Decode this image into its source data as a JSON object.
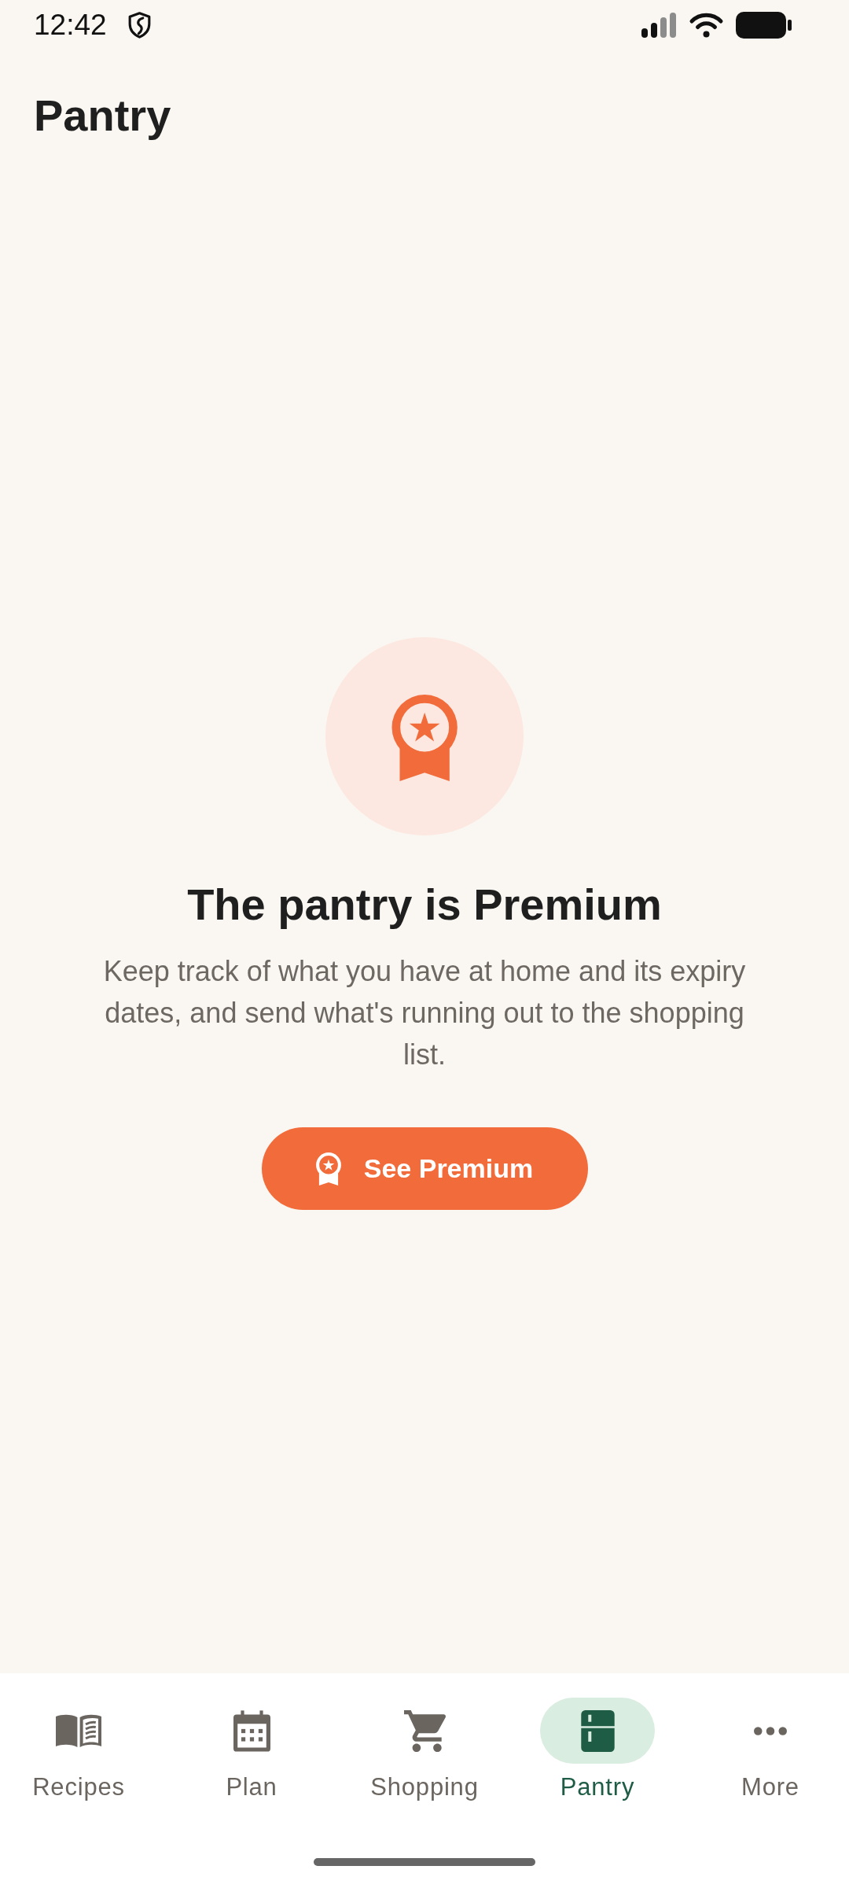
{
  "status_bar": {
    "time": "12:42"
  },
  "header": {
    "title": "Pantry"
  },
  "premium_prompt": {
    "title": "The pantry is Premium",
    "message": "Keep track of what you have at home and its expiry dates, and send what's running out to the shopping list.",
    "button": {
      "label": "See Premium"
    }
  },
  "bottom_nav": {
    "items": [
      {
        "label": "Recipes",
        "selected": false
      },
      {
        "label": "Plan",
        "selected": false
      },
      {
        "label": "Shopping",
        "selected": false
      },
      {
        "label": "Pantry",
        "selected": true
      },
      {
        "label": "More",
        "selected": false
      }
    ]
  }
}
